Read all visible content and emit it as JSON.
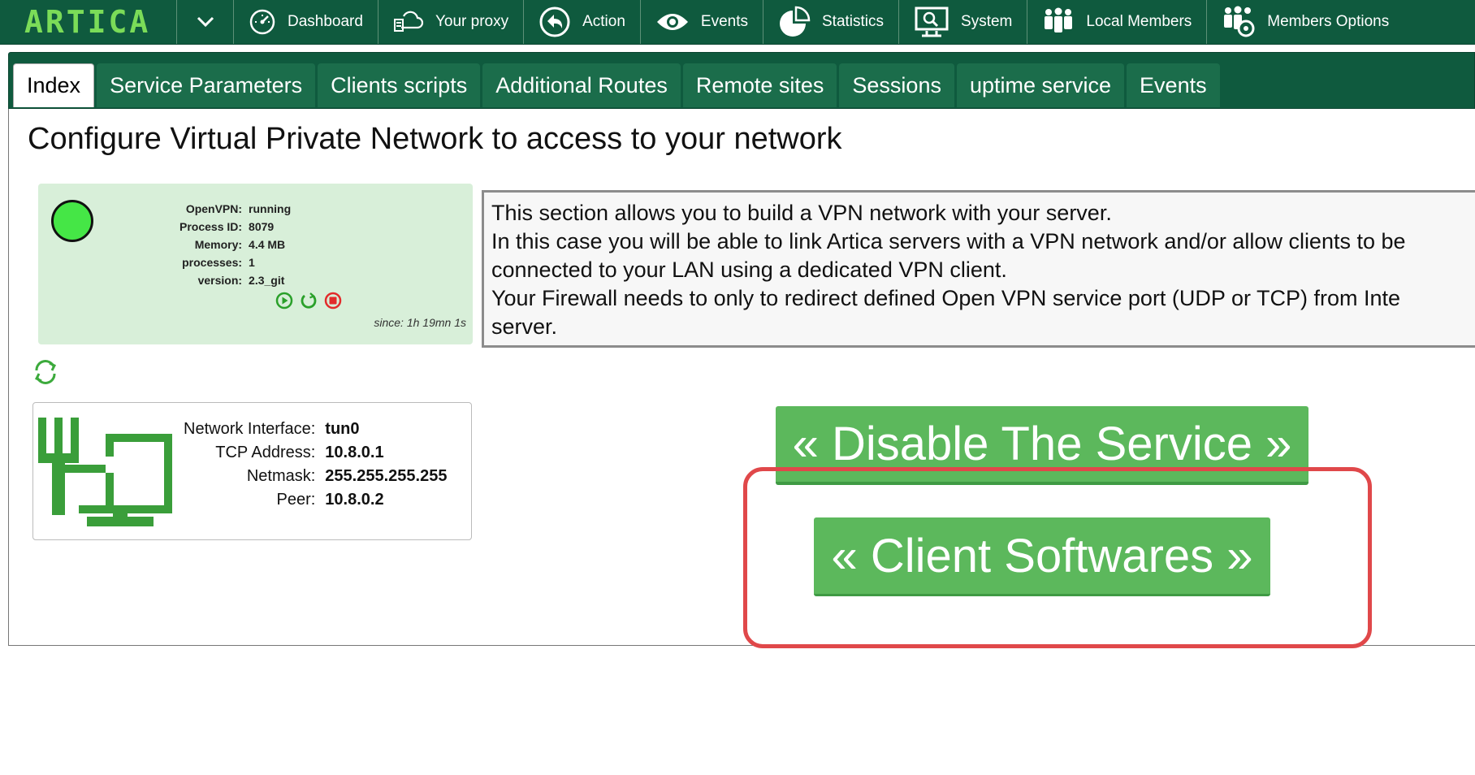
{
  "app": {
    "logo": "ARTICA"
  },
  "topnav": {
    "items": [
      {
        "label": "Dashboard",
        "icon": "dashboard-gauge-icon"
      },
      {
        "label": "Your proxy",
        "icon": "proxy-cloud-icon"
      },
      {
        "label": "Action",
        "icon": "back-arrow-icon"
      },
      {
        "label": "Events",
        "icon": "eye-icon"
      },
      {
        "label": "Statistics",
        "icon": "pie-chart-icon"
      },
      {
        "label": "System",
        "icon": "monitor-search-icon"
      },
      {
        "label": "Local Members",
        "icon": "members-icon"
      },
      {
        "label": "Members Options",
        "icon": "members-gear-icon"
      }
    ]
  },
  "tabs": [
    {
      "label": "Index",
      "active": true
    },
    {
      "label": "Service Parameters"
    },
    {
      "label": "Clients scripts"
    },
    {
      "label": "Additional Routes"
    },
    {
      "label": "Remote sites"
    },
    {
      "label": "Sessions"
    },
    {
      "label": "uptime service"
    },
    {
      "label": "Events"
    }
  ],
  "page": {
    "title": "Configure Virtual Private Network to access to your network"
  },
  "status": {
    "rows": [
      {
        "key": "OpenVPN:",
        "value": "running"
      },
      {
        "key": "Process ID:",
        "value": "8079"
      },
      {
        "key": "Memory:",
        "value": "4.4 MB"
      },
      {
        "key": "processes:",
        "value": "1"
      },
      {
        "key": "version:",
        "value": "2.3_git"
      }
    ],
    "since": "since: 1h 19mn 1s",
    "led_color": "#45e646"
  },
  "interface": {
    "rows": [
      {
        "key": "Network Interface:",
        "value": "tun0"
      },
      {
        "key": "TCP Address:",
        "value": "10.8.0.1"
      },
      {
        "key": "Netmask:",
        "value": "255.255.255.255"
      },
      {
        "key": "Peer:",
        "value": "10.8.0.2"
      }
    ]
  },
  "info": {
    "lines": [
      "This section allows you to build a VPN network with your server.",
      "In this case you will be able to link Artica servers with a VPN network and/or allow clients to be",
      "connected to your LAN using a dedicated VPN client.",
      "Your Firewall needs to only to redirect defined Open VPN service port (UDP or TCP) from Inte",
      "server."
    ]
  },
  "buttons": {
    "disable": "« Disable The Service »",
    "client": "« Client Softwares »"
  },
  "colors": {
    "nav_bg": "#0f5a3e",
    "button_green": "#5cb85c",
    "highlight_red": "#e0484a"
  }
}
